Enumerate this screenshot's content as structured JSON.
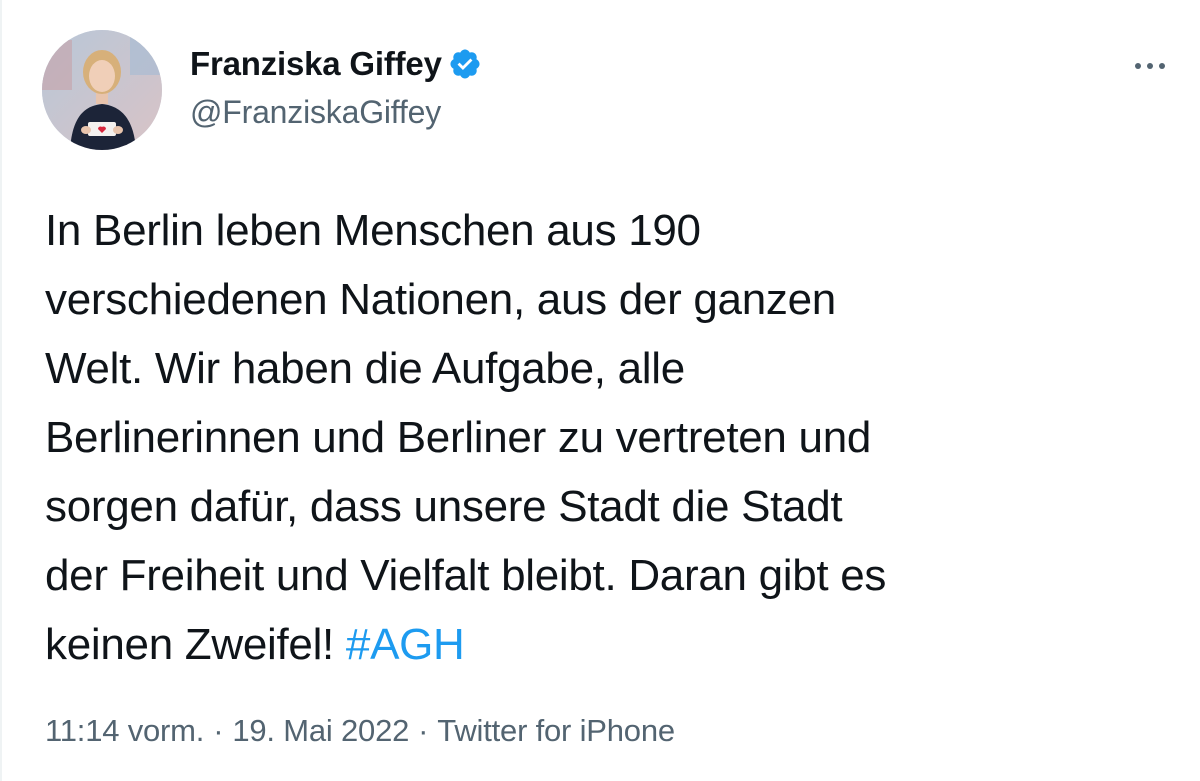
{
  "author": {
    "name": "Franziska Giffey",
    "handle": "@FranziskaGiffey",
    "verified": true
  },
  "tweet": {
    "lines": [
      "In Berlin leben Menschen aus 190",
      "verschiedenen Nationen, aus der ganzen",
      "Welt. Wir haben die Aufgabe, alle",
      "Berlinerinnen und Berliner zu vertreten und",
      "sorgen dafür, dass unsere Stadt die Stadt",
      "der Freiheit und Vielfalt bleibt. Daran gibt es",
      "keinen Zweifel! "
    ],
    "hashtag": "#AGH"
  },
  "meta": {
    "time": "11:14 vorm.",
    "separator": "·",
    "date": "19. Mai 2022",
    "source": "Twitter for iPhone"
  },
  "colors": {
    "text": "#0f1419",
    "secondary": "#536471",
    "link": "#1d9bf0",
    "verified_badge": "#1d9bf0"
  },
  "icons": {
    "verified": "verified-badge-icon",
    "more": "more-options-icon"
  }
}
